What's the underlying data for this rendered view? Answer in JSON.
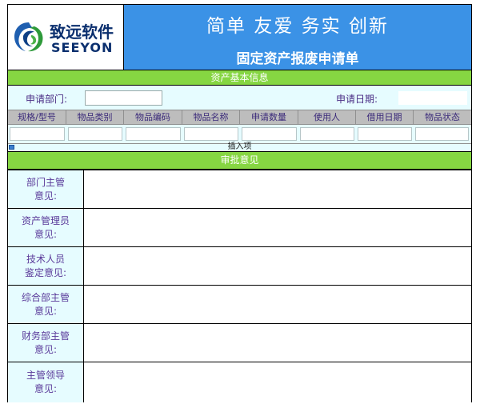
{
  "header": {
    "logo_cn": "致远软件",
    "logo_en": "SEEYON",
    "slogan": "简单 友爱 务实 创新",
    "form_title": "固定资产报废申请单",
    "banner_color": "#3b92e6"
  },
  "section_basic": {
    "title": "资产基本信息",
    "dept_label": "申请部门:",
    "dept_value": "",
    "date_label": "申请日期:",
    "date_value": ""
  },
  "items_table": {
    "columns": [
      "规格/型号",
      "物品类别",
      "物品编码",
      "物品名称",
      "申请数量",
      "使用人",
      "借用日期",
      "物品状态"
    ],
    "rows": [
      [
        "",
        "",
        "",
        "",
        "",
        "",
        "",
        ""
      ]
    ],
    "insert_label": "插入项"
  },
  "section_approval": {
    "title": "审批意见",
    "opinions": [
      {
        "label": "部门主管\n意见:",
        "value": ""
      },
      {
        "label": "资产管理员\n意见:",
        "value": ""
      },
      {
        "label": "技术人员\n鉴定意见:",
        "value": ""
      },
      {
        "label": "综合部主管\n意见:",
        "value": ""
      },
      {
        "label": "财务部主管\n意见:",
        "value": ""
      },
      {
        "label": "主管领导\n意见:",
        "value": ""
      }
    ]
  },
  "colors": {
    "section_bar": "#86d642",
    "label_bg": "#e6fcff",
    "label_text": "#5a3a9a"
  }
}
